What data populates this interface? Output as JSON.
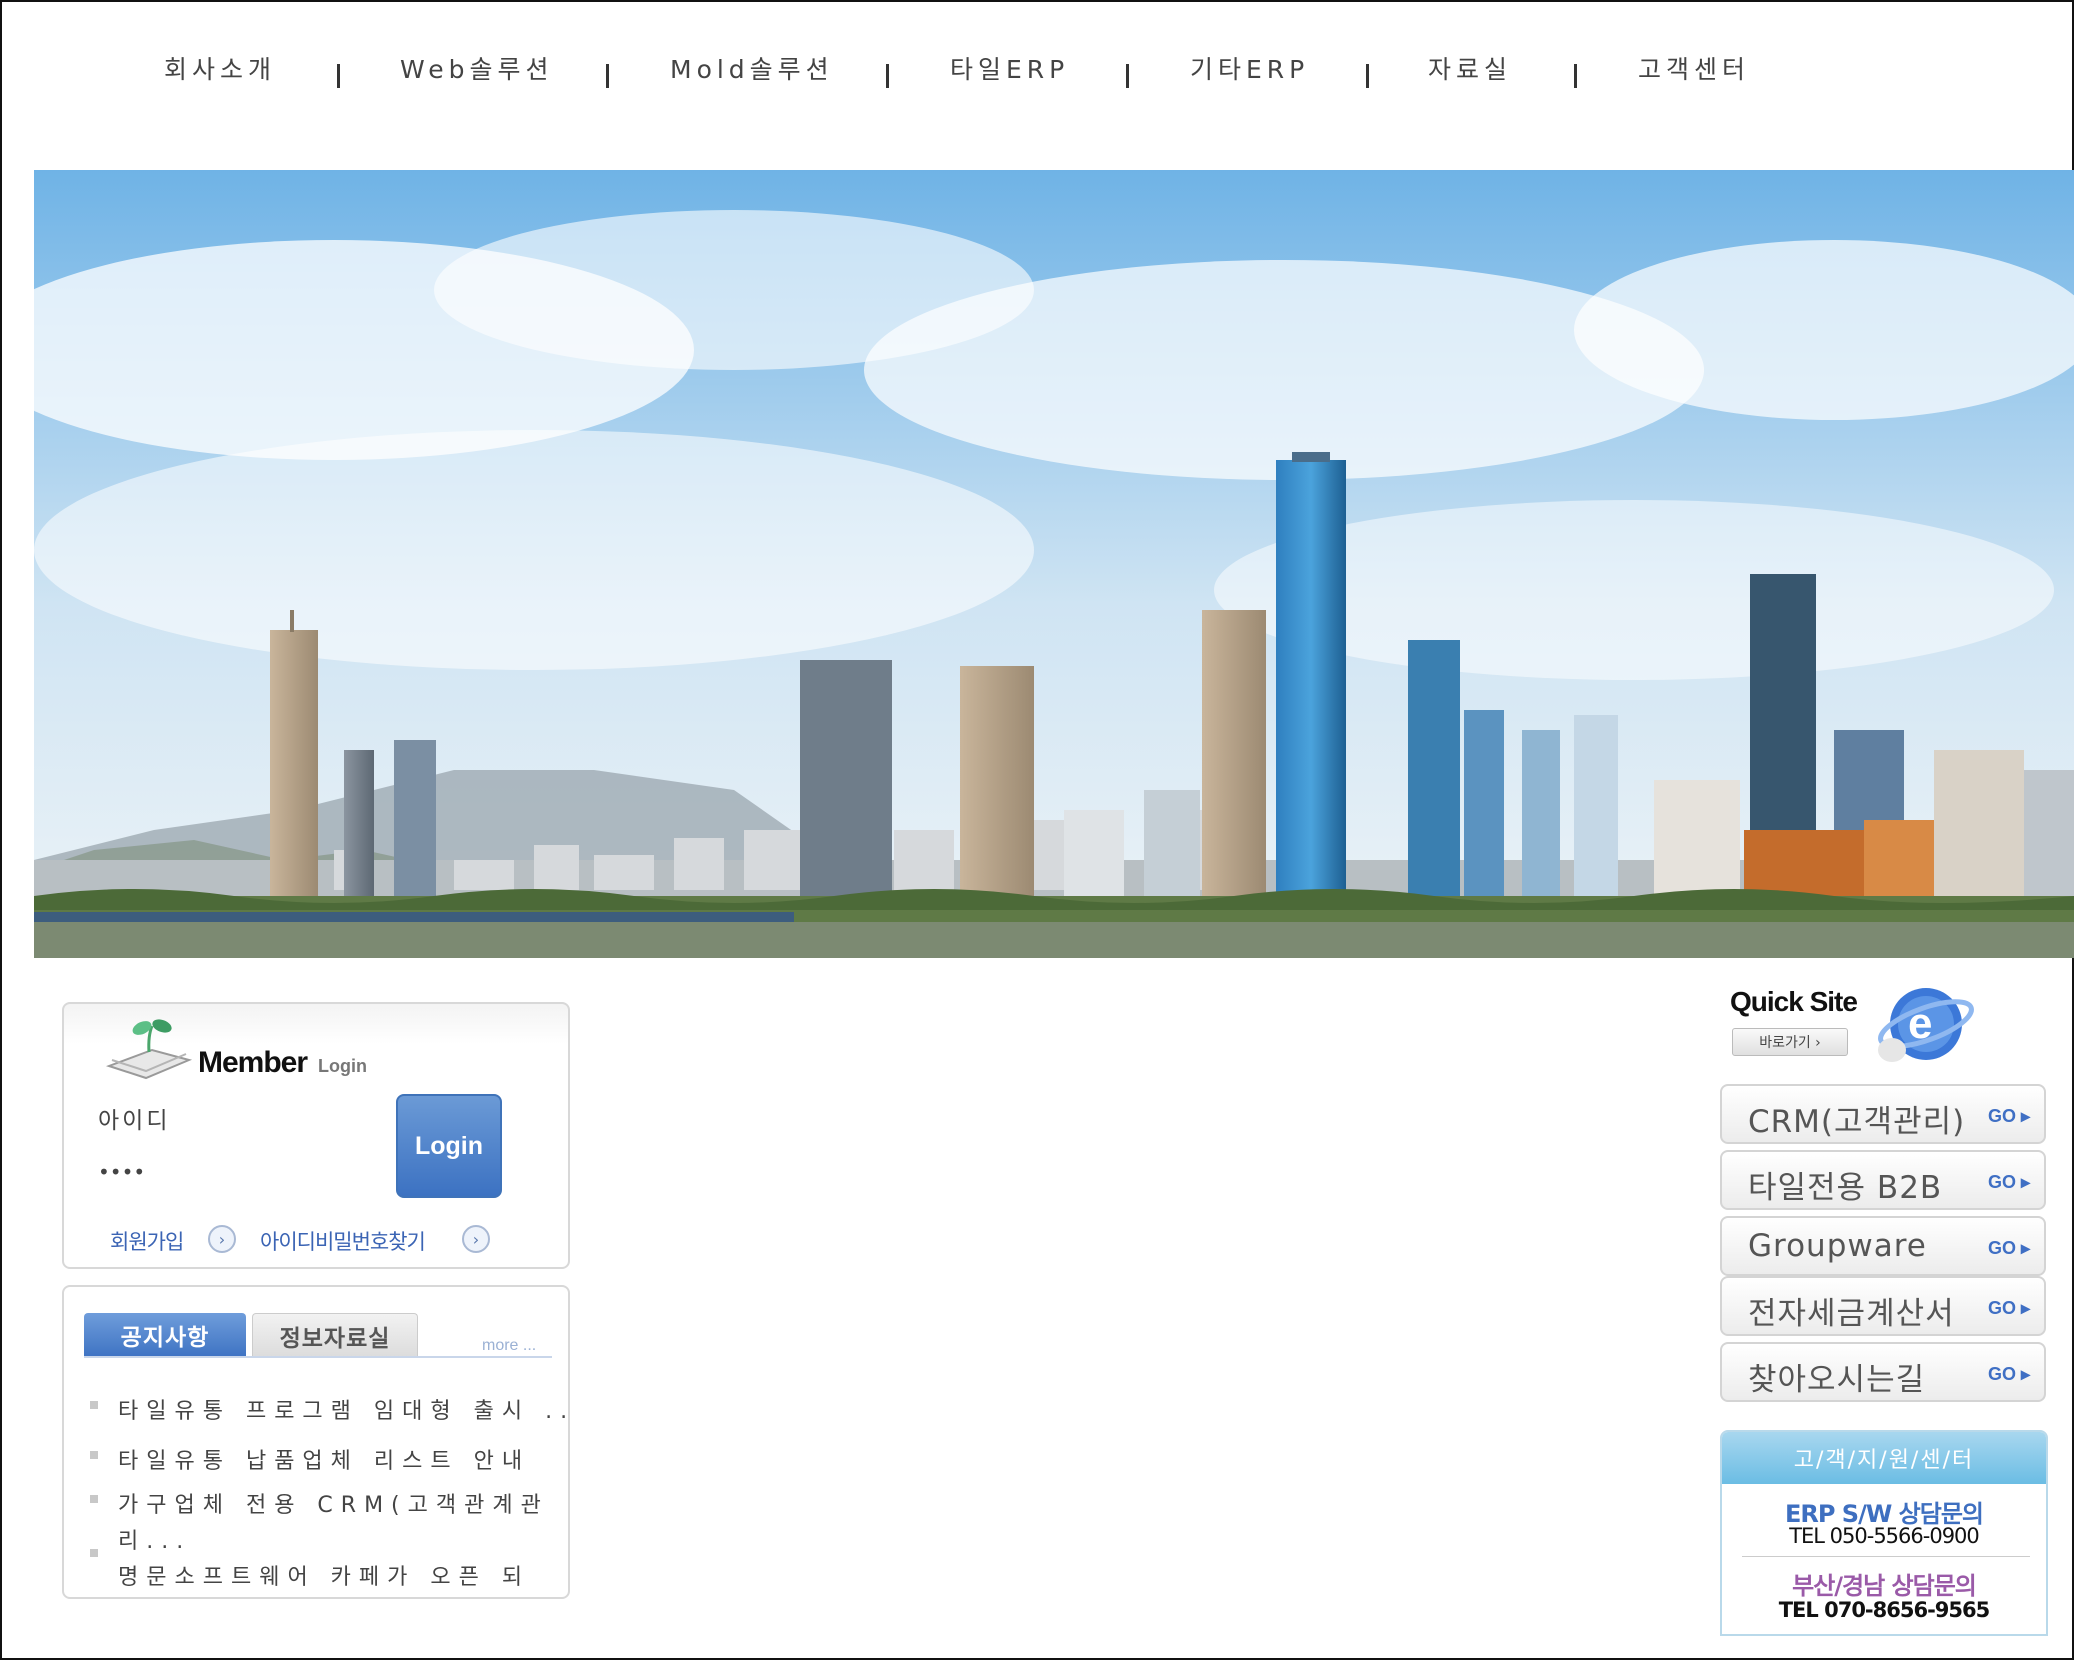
{
  "nav": {
    "items": [
      "회사소개",
      "Web솔루션",
      "Mold솔루션",
      "타일ERP",
      "기타ERP",
      "자료실",
      "고객센터"
    ]
  },
  "hero": {
    "sky_top": "#6fb3e6",
    "sky_bottom": "#e9f1f6"
  },
  "member": {
    "title": "Member",
    "subtitle": "Login",
    "id_value": "아이디",
    "pw_value": "••••",
    "login_label": "Login",
    "join_label": "회원가입",
    "find_label": "아이디비밀번호찾기"
  },
  "notice": {
    "tab_active": "공지사항",
    "tab_inactive": "정보자료실",
    "more_label": "more ...",
    "items": [
      "타일유통 프로그램 임대형 출시 ...",
      "타일유통 납품업체 리스트 안내",
      "가구업체 전용 CRM(고객관계관",
      "리...",
      "명문소프트웨어 카페가 오픈 되"
    ]
  },
  "quick_site": {
    "title": "Quick Site",
    "subtitle": "바로가기 ›",
    "go_label": "GO ▸",
    "buttons": [
      "CRM(고객관리)",
      "타일전용 B2B",
      "Groupware",
      "전자세금계산서",
      "찾아오시는길"
    ]
  },
  "support": {
    "header": "고/객/지/원/센/터",
    "line1_title": "ERP S/W 상담문의",
    "line1_tel": "TEL 050-5566-0900",
    "line2_title": "부산/경남 상담문의",
    "line2_tel": "TEL 070-8656-9565",
    "color1": "#3e6fc0",
    "color2": "#9a5aa8"
  },
  "colors": {
    "accent": "#3c72c2",
    "link": "#3b64b4"
  }
}
